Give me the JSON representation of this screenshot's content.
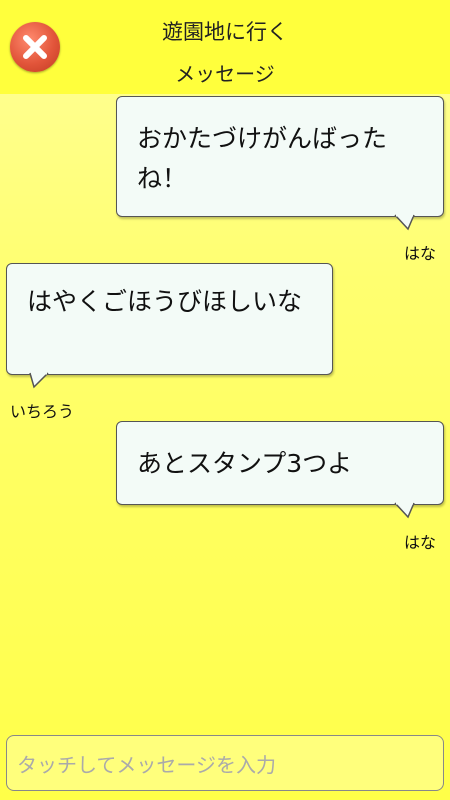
{
  "header": {
    "title": "遊園地に行く",
    "subtitle": "メッセージ"
  },
  "messages": [
    {
      "text": "おかたづけがんばったね！",
      "sender": "はな",
      "side": "right"
    },
    {
      "text": "はやくごほうびほしいな",
      "sender": "いちろう",
      "side": "left"
    },
    {
      "text": "あとスタンプ3つよ",
      "sender": "はな",
      "side": "right"
    }
  ],
  "input": {
    "placeholder": "タッチしてメッセージを入力"
  },
  "colors": {
    "header": "#ffff3c",
    "bubble": "#f3fbf7",
    "close_button": "#e2553a"
  },
  "icons": {
    "close": "close-icon"
  }
}
